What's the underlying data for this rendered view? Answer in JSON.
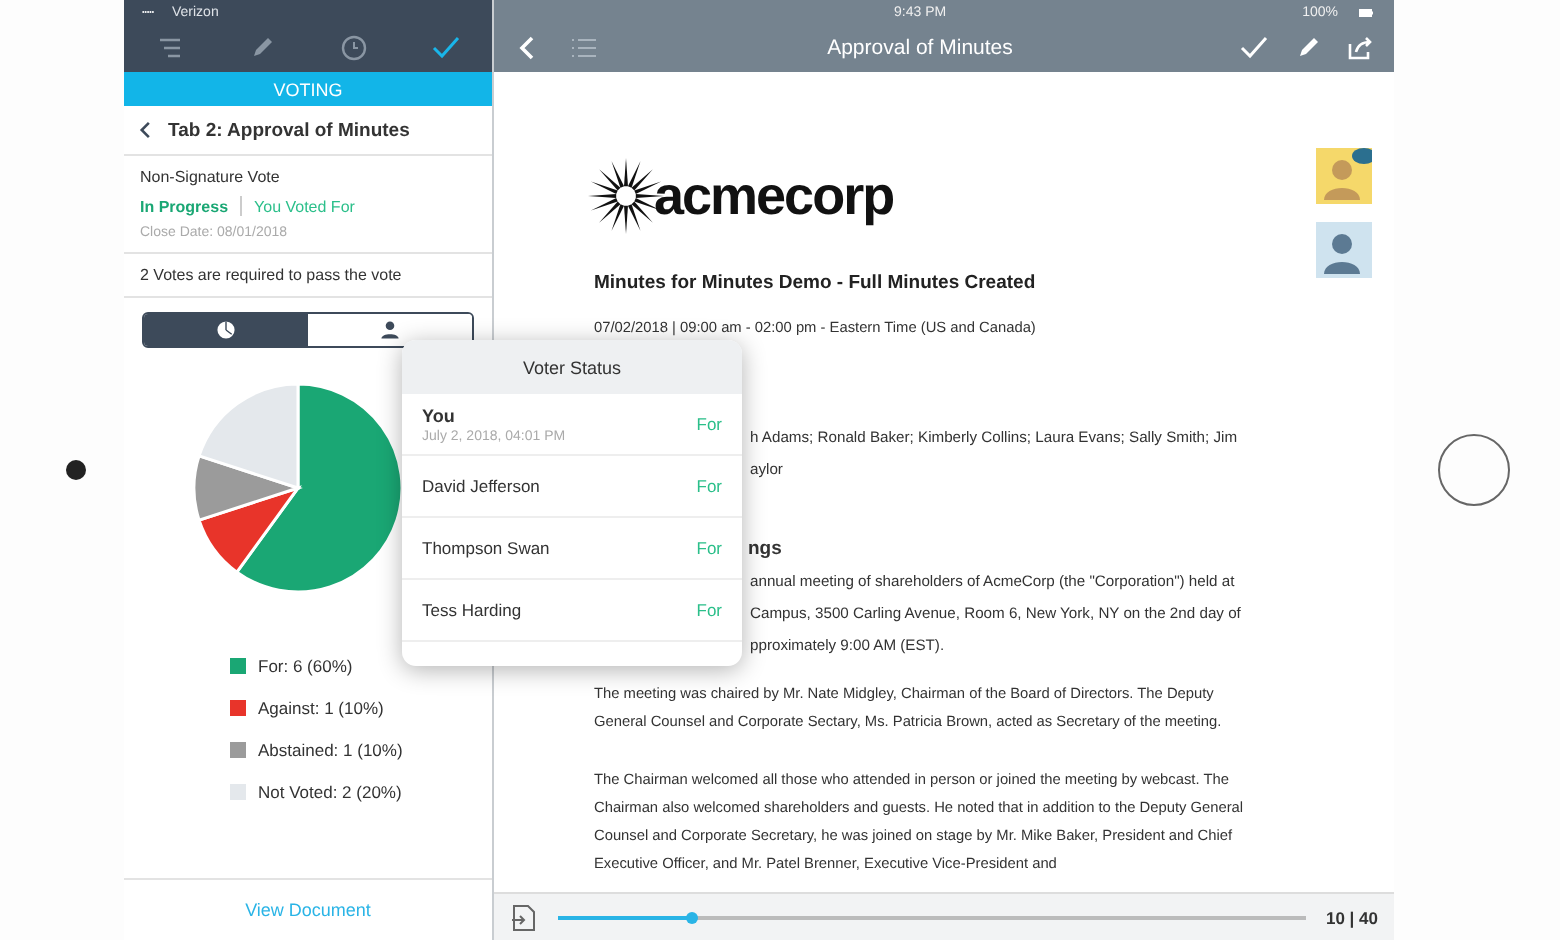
{
  "left_panel": {
    "status_bar": {
      "carrier": "Verizon"
    },
    "section_title": "VOTING",
    "header": {
      "title": "Tab 2: Approval of Minutes"
    },
    "vote": {
      "type": "Non-Signature Vote",
      "status": "In Progress",
      "my_vote": "You Voted For",
      "close_date": "Close Date: 08/01/2018",
      "requirement": "2 Votes are required to pass the vote"
    },
    "view_tabs": [
      {
        "kind": "chart",
        "selected": true
      },
      {
        "kind": "people",
        "selected": false
      }
    ],
    "chart_data": {
      "type": "pie",
      "categories": [
        "For: 6 (60%)",
        "Against: 1 (10%)",
        "Abstained: 1 (10%)",
        "Not Voted: 2 (20%)"
      ],
      "series": [
        {
          "values": [
            60,
            10,
            10,
            20
          ]
        }
      ],
      "colors": [
        "#1aa774",
        "#e8342a",
        "#9b9b9b",
        "#e4e8ec"
      ]
    },
    "footer_link": "View Document"
  },
  "voter_status": {
    "title": "Voter Status",
    "voters": [
      {
        "name": "You",
        "date": "July 2, 2018, 04:01 PM",
        "vote": "For"
      },
      {
        "name": "David Jefferson",
        "vote": "For"
      },
      {
        "name": "Thompson Swan",
        "vote": "For"
      },
      {
        "name": "Tess Harding",
        "vote": "For"
      }
    ]
  },
  "document": {
    "status_bar": {
      "time": "9:43 PM",
      "battery": "100%"
    },
    "title": "Approval of Minutes",
    "logo": "acmecorp",
    "heading": "Minutes for Minutes Demo - Full Minutes Created",
    "date_line": "07/02/2018 | 09:00 am - 02:00 pm - Eastern Time (US and Canada)",
    "partial_lines": [
      {
        "kind": "text",
        "text": "h Adams; Ronald Baker; Kimberly Collins; Laura Evans; Sally Smith; Jim"
      },
      {
        "kind": "text",
        "text": "aylor"
      },
      {
        "kind": "gap"
      },
      {
        "kind": "heading",
        "text": "ngs"
      },
      {
        "kind": "text",
        "text": "annual meeting of shareholders of AcmeCorp (the \"Corporation\") held at"
      },
      {
        "kind": "text",
        "text": "Campus, 3500 Carling Avenue, Room 6, New York, NY on the 2nd day of"
      },
      {
        "kind": "text",
        "text": "pproximately 9:00 AM (EST)."
      }
    ],
    "paragraphs": [
      "The meeting was chaired by Mr. Nate Midgley, Chairman of the Board of Directors. The Deputy General Counsel and Corporate Sectary, Ms. Patricia Brown, acted as Secretary of the meeting.",
      "The Chairman welcomed all those who attended in person or joined the meeting by webcast. The Chairman also welcomed shareholders and guests. He noted that in addition to the Deputy General Counsel and Corporate Secretary, he was joined on stage by Mr. Mike Baker, President and Chief Executive Officer, and Mr. Patel Brenner, Executive Vice-President and"
    ],
    "progress": {
      "level": 0.18,
      "page": "10 | 40"
    }
  }
}
